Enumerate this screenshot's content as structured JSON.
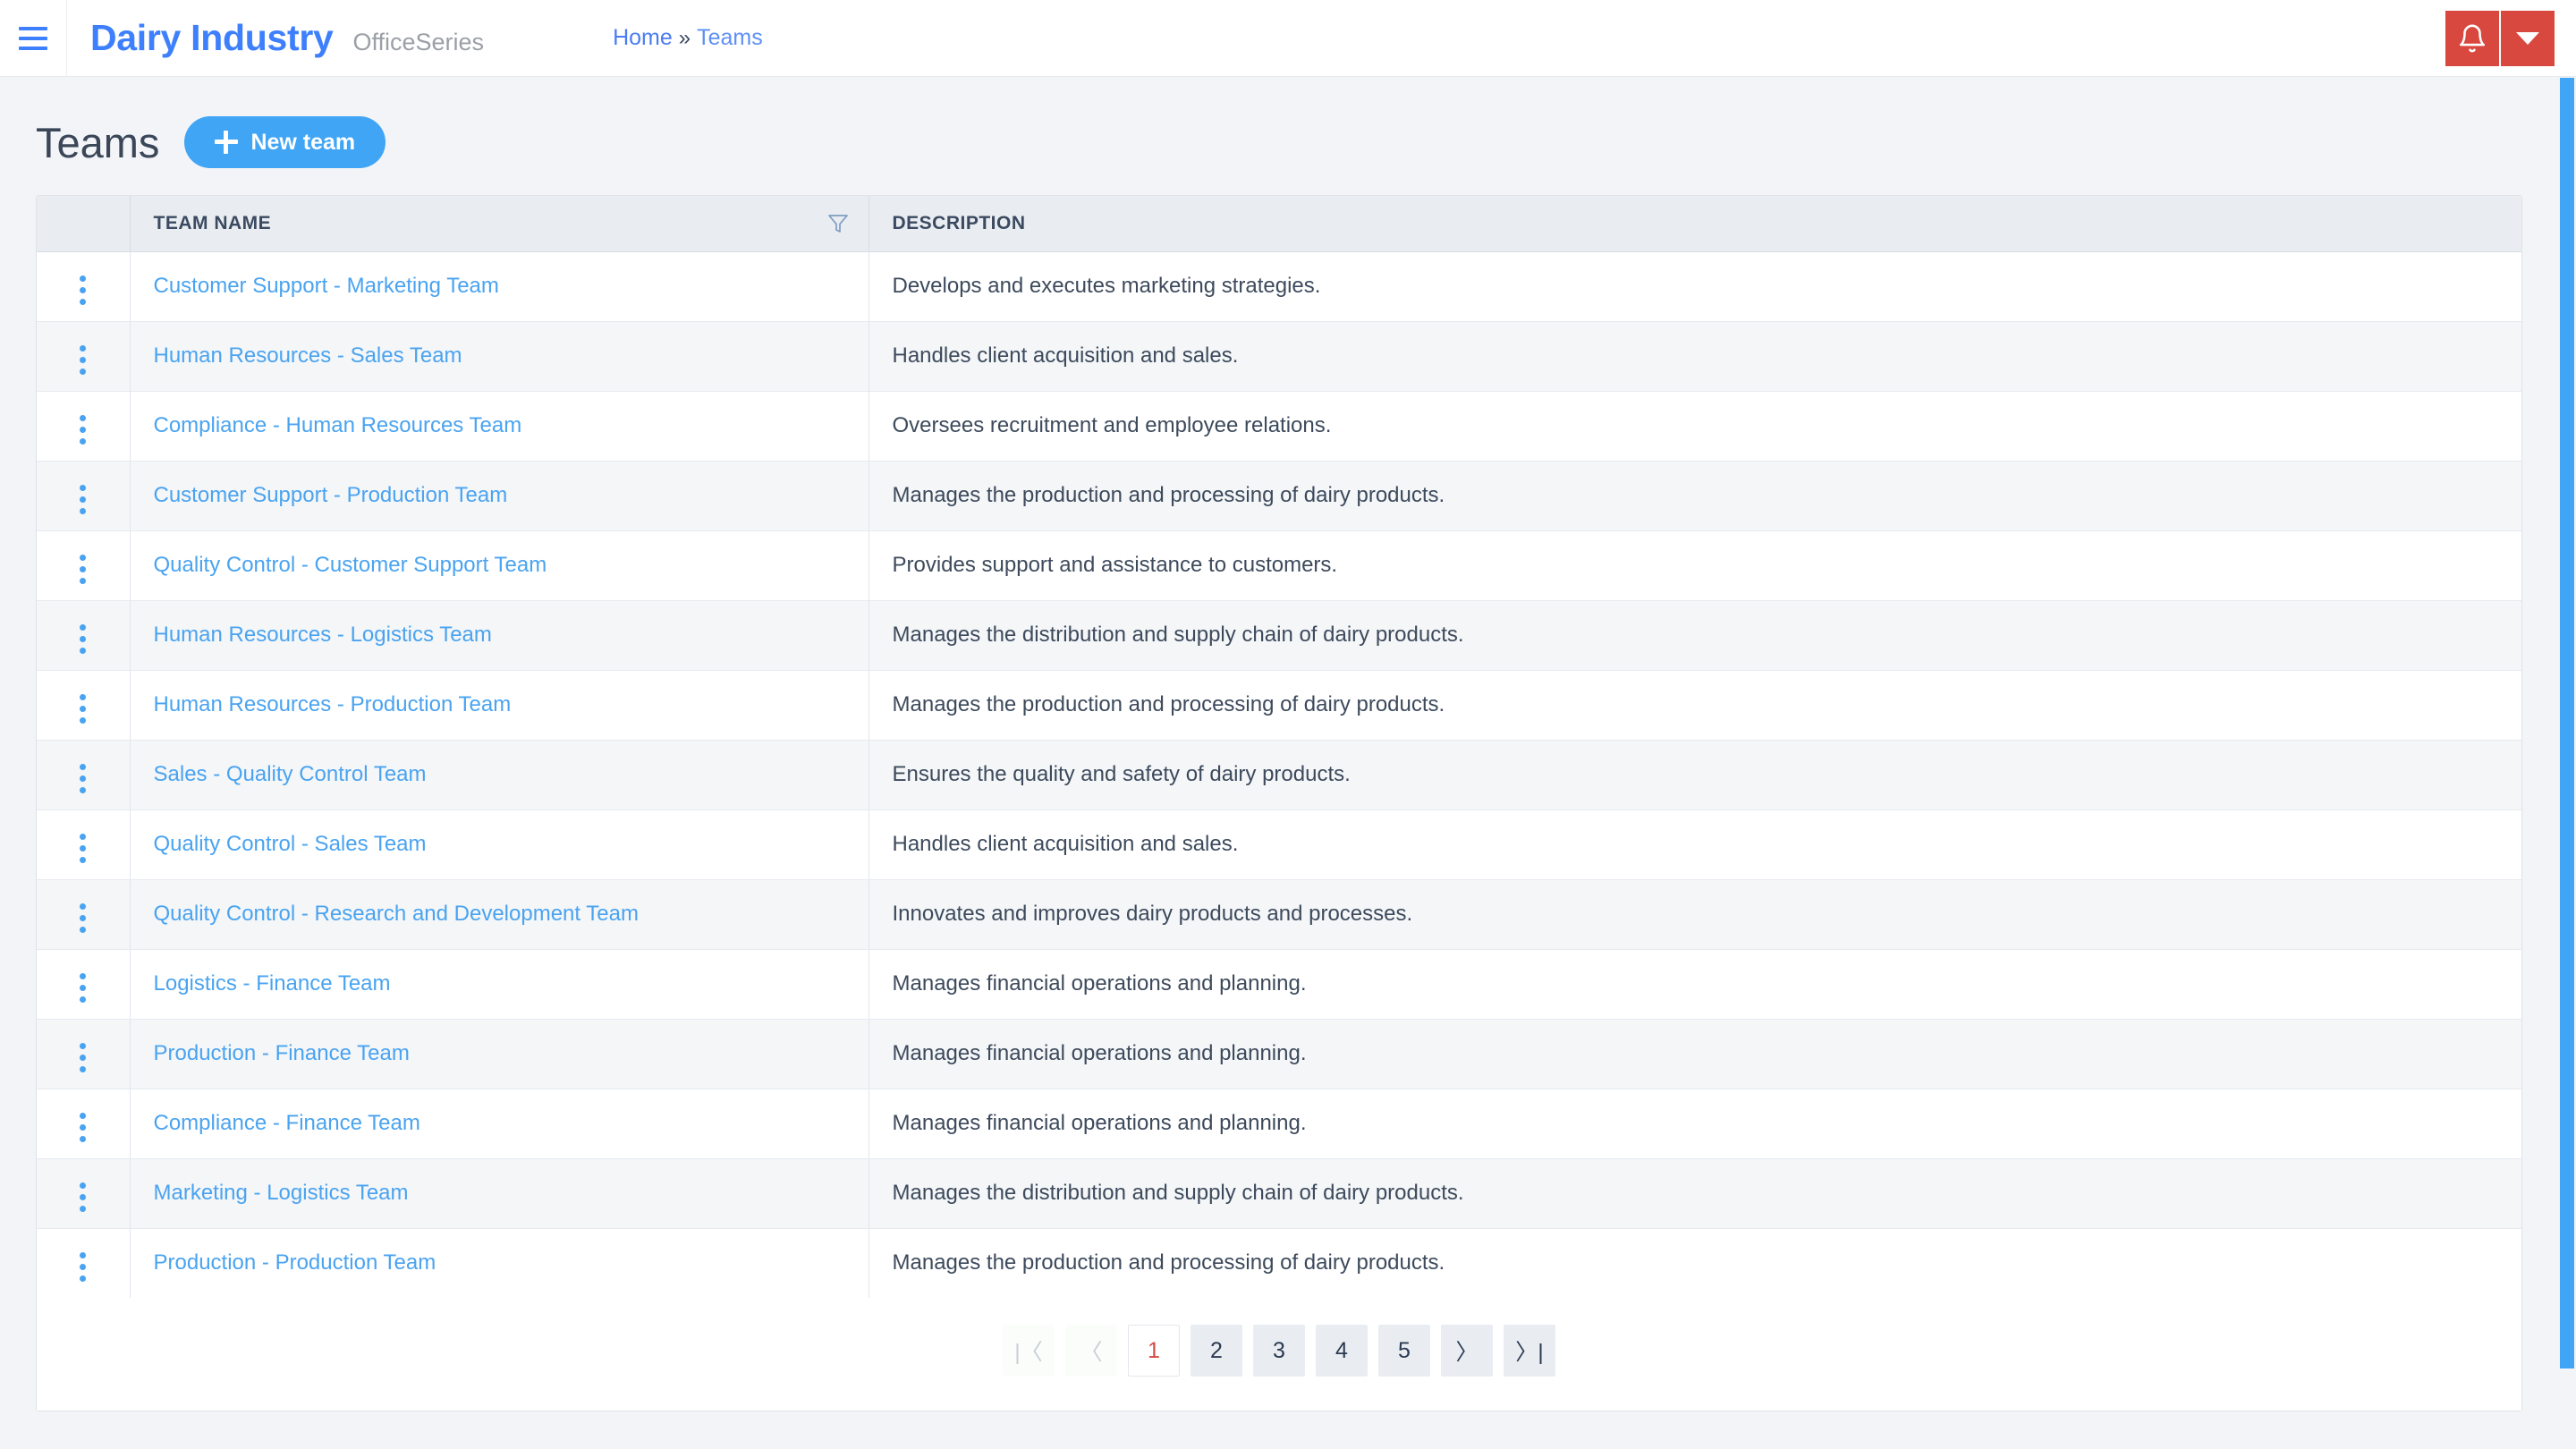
{
  "topbar": {
    "menu_icon": "hamburger-icon",
    "brand_title": "Dairy Industry",
    "brand_sub": "OfficeSeries",
    "breadcrumb": {
      "home": "Home",
      "separator": "»",
      "current": "Teams"
    },
    "bell_icon": "bell-icon",
    "caret_icon": "chevron-down-icon",
    "accent_red": "#d9483f",
    "accent_blue": "#3d7ffc"
  },
  "page": {
    "title": "Teams",
    "new_button_label": "New team",
    "new_button_icon": "plus-icon",
    "new_button_color": "#41a5f5"
  },
  "table": {
    "columns": {
      "menu": "",
      "name": "TEAM NAME",
      "description": "DESCRIPTION"
    },
    "filter_icon": "filter-icon",
    "row_menu_icon": "kebab-menu-icon",
    "link_color": "#4aa3f0",
    "rows": [
      {
        "name": "Customer Support - Marketing Team",
        "description": "Develops and executes marketing strategies."
      },
      {
        "name": "Human Resources - Sales Team",
        "description": "Handles client acquisition and sales."
      },
      {
        "name": "Compliance - Human Resources Team",
        "description": "Oversees recruitment and employee relations."
      },
      {
        "name": "Customer Support - Production Team",
        "description": "Manages the production and processing of dairy products."
      },
      {
        "name": "Quality Control - Customer Support Team",
        "description": "Provides support and assistance to customers."
      },
      {
        "name": "Human Resources - Logistics Team",
        "description": "Manages the distribution and supply chain of dairy products."
      },
      {
        "name": "Human Resources - Production Team",
        "description": "Manages the production and processing of dairy products."
      },
      {
        "name": "Sales - Quality Control Team",
        "description": "Ensures the quality and safety of dairy products."
      },
      {
        "name": "Quality Control - Sales Team",
        "description": "Handles client acquisition and sales."
      },
      {
        "name": "Quality Control - Research and Development Team",
        "description": "Innovates and improves dairy products and processes."
      },
      {
        "name": "Logistics - Finance Team",
        "description": "Manages financial operations and planning."
      },
      {
        "name": "Production - Finance Team",
        "description": "Manages financial operations and planning."
      },
      {
        "name": "Compliance - Finance Team",
        "description": "Manages financial operations and planning."
      },
      {
        "name": "Marketing - Logistics Team",
        "description": "Manages the distribution and supply chain of dairy products."
      },
      {
        "name": "Production - Production Team",
        "description": "Manages the production and processing of dairy products."
      }
    ]
  },
  "pagination": {
    "first_label": "|〈",
    "prev_label": "〈",
    "next_label": "〉",
    "last_label": "〉|",
    "pages": [
      "1",
      "2",
      "3",
      "4",
      "5"
    ],
    "active_page": "1",
    "active_color": "#d9483f"
  }
}
